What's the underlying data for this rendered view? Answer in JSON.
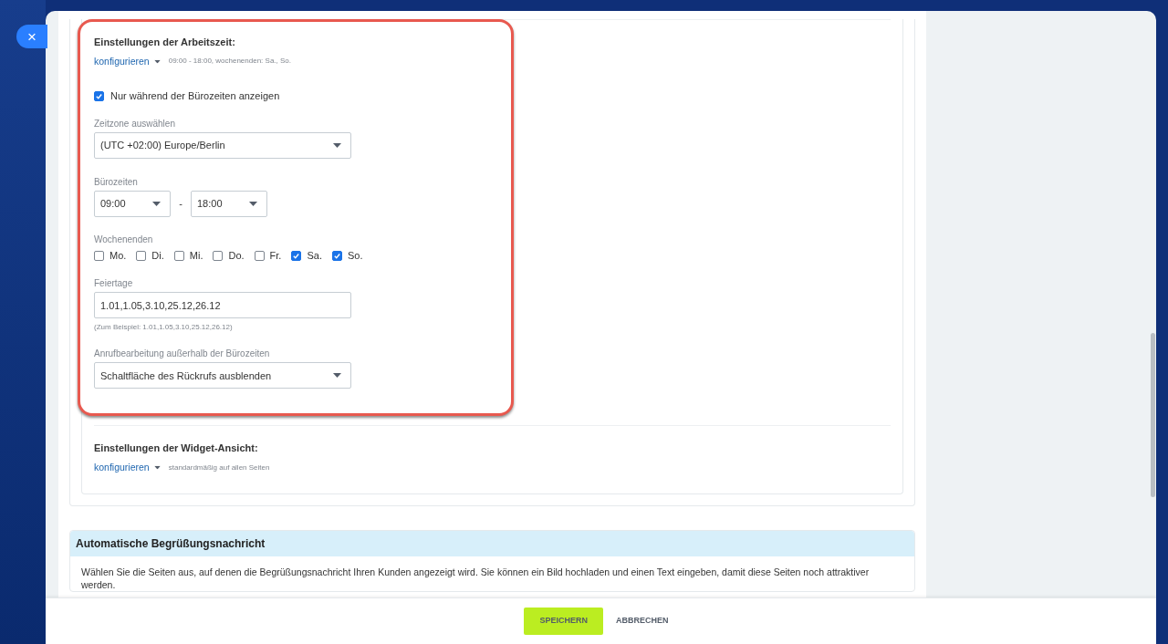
{
  "close_button": {
    "label": "×"
  },
  "work_time": {
    "title": "Einstellungen der Arbeitszeit:",
    "configure_link": "konfigurieren",
    "summary": "09:00 - 18:00, wochenenden: Sa., So.",
    "office_hours_only": {
      "label": "Nur während der Bürozeiten anzeigen",
      "checked": true
    },
    "timezone": {
      "label": "Zeitzone auswählen",
      "value": "(UTC +02:00) Europe/Berlin"
    },
    "office_hours": {
      "label": "Bürozeiten",
      "from": "09:00",
      "separator": "-",
      "to": "18:00"
    },
    "weekends": {
      "label": "Wochenenden",
      "days": [
        {
          "label": "Mo.",
          "checked": false
        },
        {
          "label": "Di.",
          "checked": false
        },
        {
          "label": "Mi.",
          "checked": false
        },
        {
          "label": "Do.",
          "checked": false
        },
        {
          "label": "Fr.",
          "checked": false
        },
        {
          "label": "Sa.",
          "checked": true
        },
        {
          "label": "So.",
          "checked": true
        }
      ]
    },
    "holidays": {
      "label": "Feiertage",
      "value": "1.01,1.05,3.10,25.12,26.12",
      "hint": "(Zum Beispiel: 1.01,1.05,3.10,25.12,26.12)"
    },
    "after_hours": {
      "label": "Anrufbearbeitung außerhalb der Bürozeiten",
      "value": "Schaltfläche des Rückrufs ausblenden"
    }
  },
  "widget_view": {
    "title": "Einstellungen der Widget-Ansicht:",
    "configure_link": "konfigurieren",
    "summary": "standardmäßig auf allen Seiten"
  },
  "greeting": {
    "title": "Automatische Begrüßungsnachricht",
    "description": "Wählen Sie die Seiten aus, auf denen die Begrüßungsnachricht Ihren Kunden angezeigt wird. Sie können ein Bild hochladen und einen Text eingeben, damit diese Seiten noch attraktiver werden."
  },
  "footer": {
    "buttons": [
      {
        "label": "SPEICHERN",
        "kind": "primary"
      },
      {
        "label": "ABBRECHEN",
        "kind": "secondary"
      }
    ]
  }
}
